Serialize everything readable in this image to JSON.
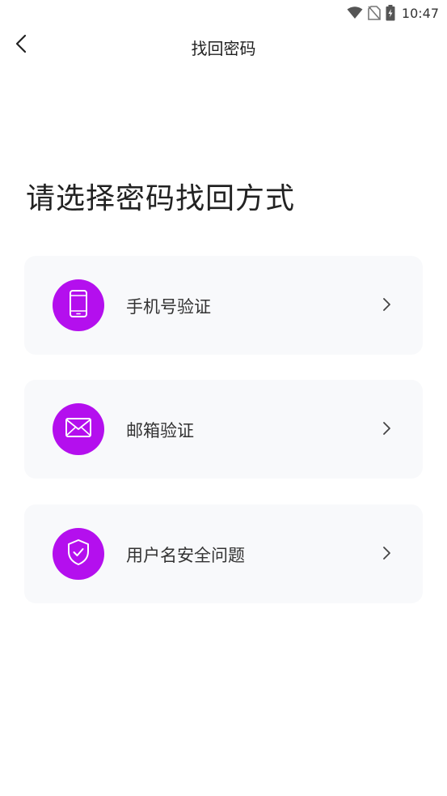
{
  "status_bar": {
    "time": "10:47",
    "icons": [
      "wifi-icon",
      "no-sim-icon",
      "battery-charging-icon"
    ]
  },
  "nav": {
    "title": "找回密码",
    "back_icon": "chevron-left-icon"
  },
  "heading": "请选择密码找回方式",
  "options": [
    {
      "label": "手机号验证",
      "icon": "phone-icon"
    },
    {
      "label": "邮箱验证",
      "icon": "mail-icon"
    },
    {
      "label": "用户名安全问题",
      "icon": "shield-check-icon"
    }
  ],
  "colors": {
    "accent": "#b40fee",
    "card_bg": "#f8f9fb",
    "text": "#222222"
  }
}
